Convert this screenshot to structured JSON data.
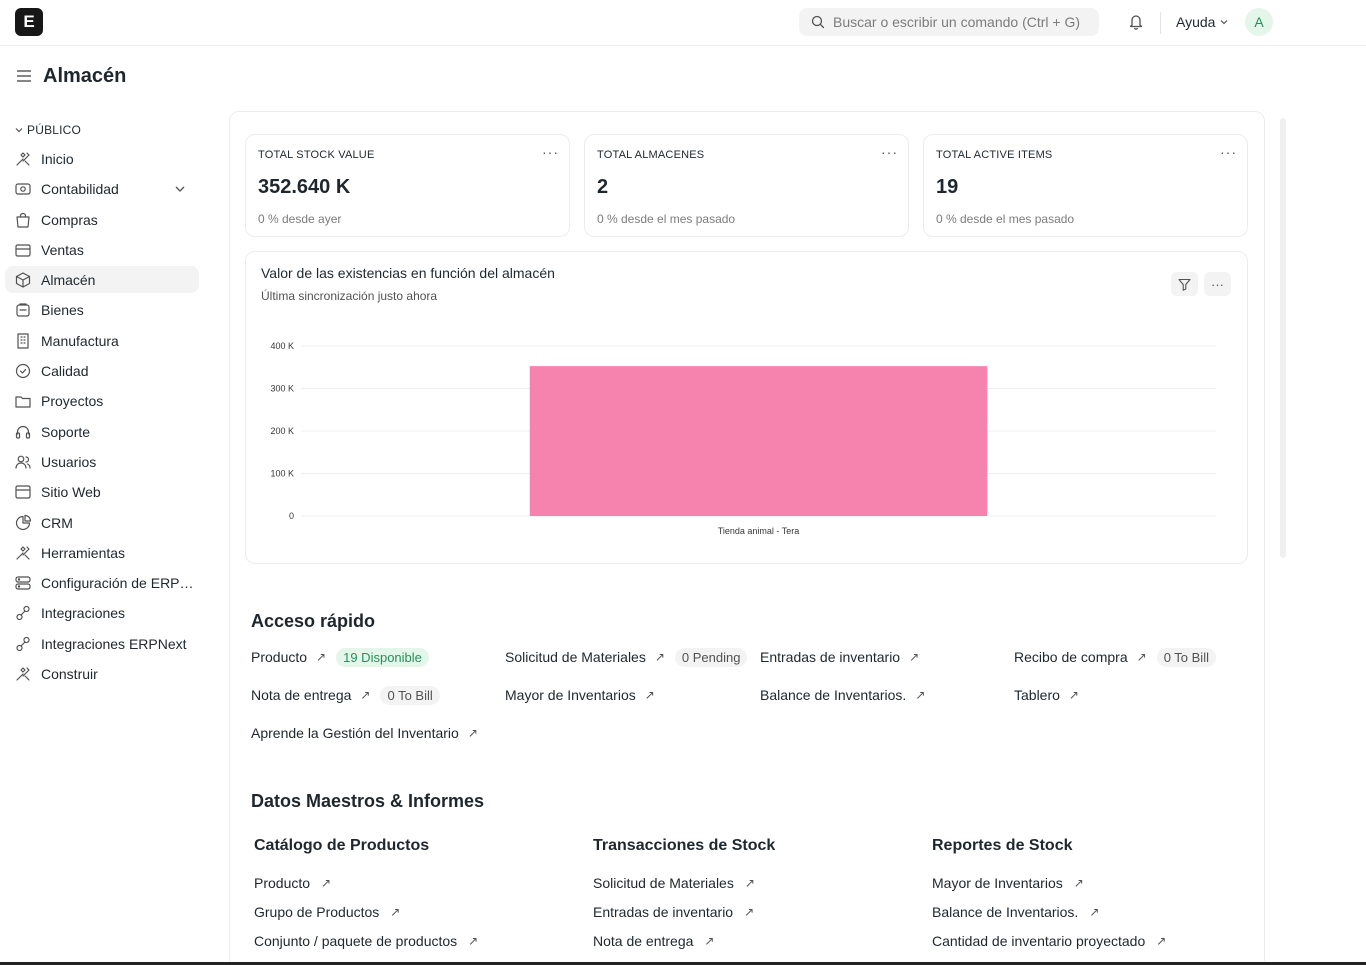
{
  "navbar": {
    "logo_letter": "E",
    "search_placeholder": "Buscar o escribir un comando (Ctrl + G)",
    "help_label": "Ayuda",
    "avatar_letter": "A"
  },
  "page": {
    "title": "Almacén"
  },
  "sidebar": {
    "section": "PÚBLICO",
    "items": [
      {
        "label": "Inicio",
        "icon": "tools-icon"
      },
      {
        "label": "Contabilidad",
        "icon": "accounting-icon"
      },
      {
        "label": "Compras",
        "icon": "shopping-bag-icon"
      },
      {
        "label": "Ventas",
        "icon": "sales-icon"
      },
      {
        "label": "Almacén",
        "icon": "box-icon"
      },
      {
        "label": "Bienes",
        "icon": "assets-icon"
      },
      {
        "label": "Manufactura",
        "icon": "factory-icon"
      },
      {
        "label": "Calidad",
        "icon": "quality-icon"
      },
      {
        "label": "Proyectos",
        "icon": "folder-icon"
      },
      {
        "label": "Soporte",
        "icon": "headset-icon"
      },
      {
        "label": "Usuarios",
        "icon": "users-icon"
      },
      {
        "label": "Sitio Web",
        "icon": "website-icon"
      },
      {
        "label": "CRM",
        "icon": "crm-icon"
      },
      {
        "label": "Herramientas",
        "icon": "tools-icon"
      },
      {
        "label": "Configuración de ERPNext",
        "icon": "settings-icon"
      },
      {
        "label": "Integraciones",
        "icon": "integration-icon"
      },
      {
        "label": "Integraciones ERPNext",
        "icon": "integration-icon"
      },
      {
        "label": "Construir",
        "icon": "build-icon"
      }
    ]
  },
  "number_cards": [
    {
      "label": "TOTAL STOCK VALUE",
      "value": "352.640 K",
      "sub": "0 % desde ayer"
    },
    {
      "label": "TOTAL ALMACENES",
      "value": "2",
      "sub": "0 % desde el mes pasado"
    },
    {
      "label": "TOTAL ACTIVE ITEMS",
      "value": "19",
      "sub": "0 % desde el mes pasado"
    }
  ],
  "chart": {
    "title": "Valor de las existencias en función del almacén",
    "subtitle": "Última sincronización justo ahora"
  },
  "chart_data": {
    "type": "bar",
    "categories": [
      "Tienda animal - Tera"
    ],
    "values": [
      352640
    ],
    "ylim": [
      0,
      400000
    ],
    "yticks": [
      0,
      100000,
      200000,
      300000,
      400000
    ],
    "ytick_labels": [
      "0",
      "100 K",
      "200 K",
      "300 K",
      "400 K"
    ],
    "color": "#f683ae",
    "grid": true
  },
  "quick_access": {
    "title": "Acceso rápido",
    "items": [
      {
        "label": "Producto",
        "badge": "19 Disponible",
        "badge_color": "green"
      },
      {
        "label": "Solicitud de Materiales",
        "badge": "0 Pending",
        "badge_color": "gray"
      },
      {
        "label": "Entradas de inventario",
        "badge": "",
        "badge_color": ""
      },
      {
        "label": "Recibo de compra",
        "badge": "0 To Bill",
        "badge_color": "gray"
      },
      {
        "label": "Nota de entrega",
        "badge": "0 To Bill",
        "badge_color": "gray"
      },
      {
        "label": "Mayor de Inventarios",
        "badge": "",
        "badge_color": ""
      },
      {
        "label": "Balance de Inventarios.",
        "badge": "",
        "badge_color": ""
      },
      {
        "label": "Tablero",
        "badge": "",
        "badge_color": ""
      },
      {
        "label": "Aprende la Gestión del Inventario",
        "badge": "",
        "badge_color": ""
      }
    ]
  },
  "masters": {
    "title": "Datos Maestros & Informes",
    "columns": [
      {
        "title": "Catálogo de Productos",
        "links": [
          "Producto",
          "Grupo de Productos",
          "Conjunto / paquete de productos"
        ]
      },
      {
        "title": "Transacciones de Stock",
        "links": [
          "Solicitud de Materiales",
          "Entradas de inventario",
          "Nota de entrega"
        ]
      },
      {
        "title": "Reportes de Stock",
        "links": [
          "Mayor de Inventarios",
          "Balance de Inventarios.",
          "Cantidad de inventario proyectado"
        ]
      }
    ]
  },
  "arrow_glyph": "↗",
  "menu_dots": "···"
}
